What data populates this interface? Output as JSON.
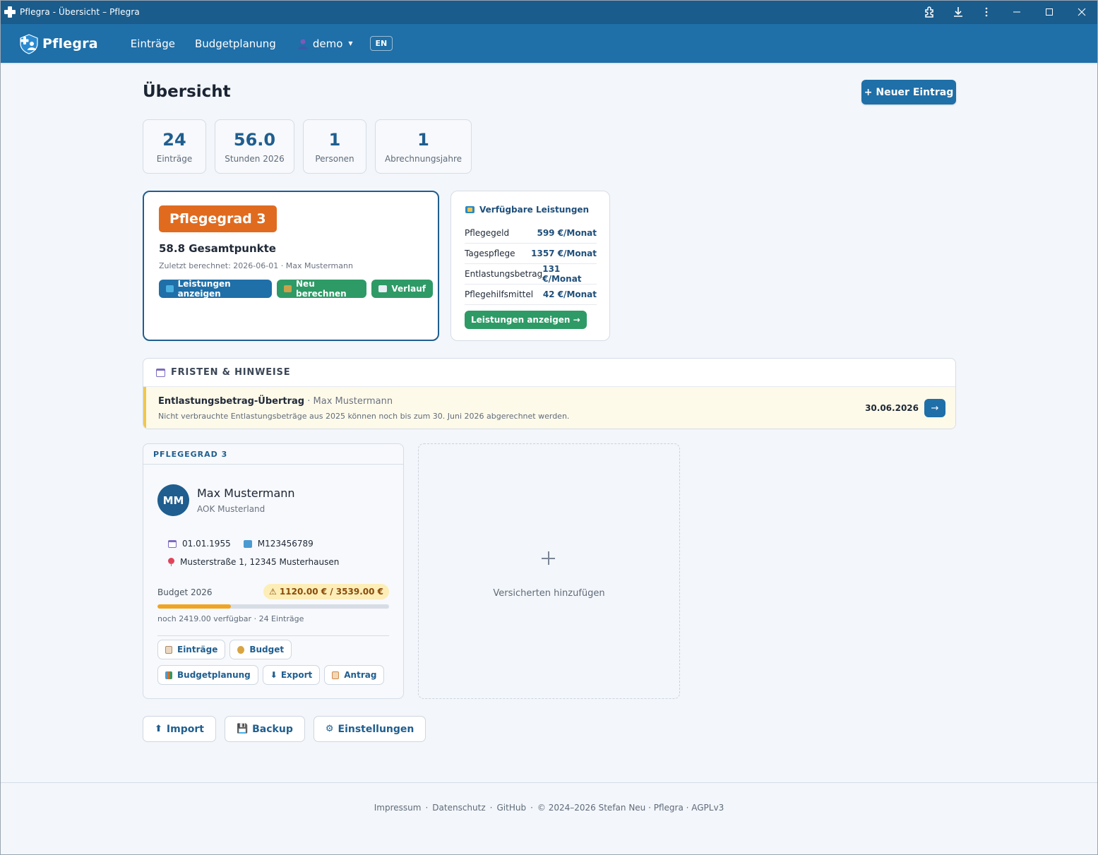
{
  "window": {
    "title": "Pflegra - Übersicht – Pflegra"
  },
  "nav": {
    "brand": "Pflegra",
    "links": [
      "Einträge",
      "Budgetplanung"
    ],
    "user": "demo",
    "lang": "EN"
  },
  "page": {
    "title": "Übersicht",
    "new_entry": "+ Neuer Eintrag"
  },
  "stats": [
    {
      "value": "24",
      "label": "Einträge"
    },
    {
      "value": "56.0",
      "label": "Stunden 2026"
    },
    {
      "value": "1",
      "label": "Personen"
    },
    {
      "value": "1",
      "label": "Abrechnungsjahre"
    }
  ],
  "pflegegrad": {
    "badge": "Pflegegrad 3",
    "points": "58.8 Gesamtpunkte",
    "meta": "Zuletzt berechnet: 2026-06-01 · Max Mustermann",
    "actions": [
      "Leistungen anzeigen",
      "Neu berechnen",
      "Verlauf"
    ]
  },
  "leistungen": {
    "title": "Verfügbare Leistungen",
    "rows": [
      {
        "name": "Pflegegeld",
        "value": "599 €/Monat"
      },
      {
        "name": "Tagespflege",
        "value": "1357 €/Monat"
      },
      {
        "name": "Entlastungsbetrag",
        "value": "131 €/Monat"
      },
      {
        "name": "Pflegehilfsmittel",
        "value": "42 €/Monat"
      }
    ],
    "button": "Leistungen anzeigen →"
  },
  "fristen": {
    "title": "FRISTEN & HINWEISE",
    "item": {
      "title": "Entlastungsbetrag-Übertrag",
      "person": " · Max Mustermann",
      "desc": "Nicht verbrauchte Entlastungsbeträge aus 2025 können noch bis zum 30. Juni 2026 abgerechnet werden.",
      "date": "30.06.2026",
      "go": "→"
    }
  },
  "person": {
    "header": "PFLEGEGRAD 3",
    "initials": "MM",
    "name": "Max Mustermann",
    "insurance": "AOK Musterland",
    "birthdate": "01.01.1955",
    "insurance_id": "M123456789",
    "address": "Musterstraße 1, 12345 Musterhausen",
    "budget_label": "Budget 2026",
    "budget_badge": "⚠ 1120.00 € / 3539.00 €",
    "budget_used_fraction": 0.316,
    "budget_note": "noch 2419.00 verfügbar · 24 Einträge",
    "actions": [
      "Einträge",
      "Budget",
      "Budgetplanung",
      "Export",
      "Antrag"
    ]
  },
  "add_insured": {
    "label": "Versicherten hinzufügen"
  },
  "bottom_actions": [
    {
      "icon": "⬆",
      "label": "Import"
    },
    {
      "icon": "💾",
      "label": "Backup"
    },
    {
      "icon": "⚙",
      "label": "Einstellungen"
    }
  ],
  "footer": {
    "links": [
      "Impressum",
      "Datenschutz",
      "GitHub"
    ],
    "copyright": "© 2024–2026 Stefan Neu · Pflegra · AGPLv3"
  },
  "colors": {
    "navbar": "#1f6fa8",
    "titlebar": "#1a5c8c",
    "pflegegrad_badge": "#e06b1f",
    "green": "#2e9a66",
    "warning_bar": "#f0c64c",
    "progress_fill": "#f0a522"
  }
}
